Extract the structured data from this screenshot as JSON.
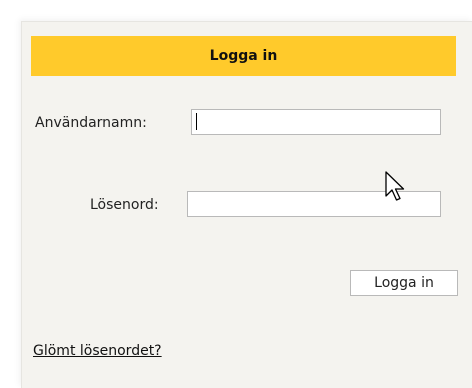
{
  "login": {
    "title": "Logga in",
    "username_label": "Användarnamn:",
    "username_value": "",
    "password_label": "Lösenord:",
    "password_value": "",
    "submit_label": "Logga in",
    "forgot_link": "Glömt lösenordet?"
  },
  "colors": {
    "header_bg": "#ffca2b",
    "panel_bg": "#f4f3ef"
  },
  "icons": {
    "mouse_cursor": "arrow-cursor-icon"
  }
}
